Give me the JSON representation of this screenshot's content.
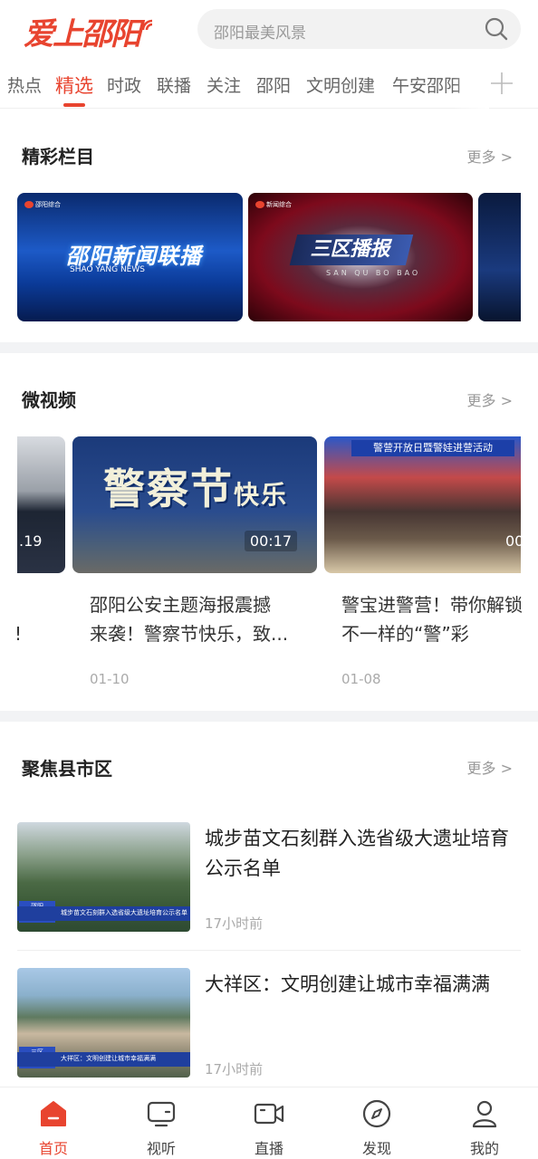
{
  "app": {
    "logo_text": "爱上邵阳",
    "search_placeholder": "邵阳最美风景"
  },
  "tabs": [
    "热点",
    "精选",
    "时政",
    "联播",
    "关注",
    "邵阳",
    "文明创建",
    "午安邵阳"
  ],
  "active_tab": "精选",
  "sections": {
    "programs": {
      "title": "精彩栏目",
      "more": "更多 >",
      "items": [
        {
          "title": "邵阳新闻联播",
          "subtitle": "SHAO YANG NEWS"
        },
        {
          "title": "三区播报",
          "subtitle": "SAN QU BO BAO"
        }
      ]
    },
    "micro_video": {
      "title": "微视频",
      "more": "更多 >",
      "partial_left_duration": ".19",
      "partial_left_text": "!",
      "items": [
        {
          "thumb_text": "警察节",
          "thumb_text_small": "快乐",
          "duration": "00:17",
          "title_line1": "邵阳公安主题海报震撼",
          "title_line2": "来袭！警察节快乐，致...",
          "date": "01-10"
        },
        {
          "thumb_banner": "警营开放日暨警娃进营活动",
          "duration": "00",
          "title_line1": "警宝进警营！带你解锁",
          "title_line2": "不一样的“警”彩",
          "date": "01-08"
        }
      ]
    },
    "county": {
      "title": "聚焦县市区",
      "more": "更多 >",
      "items": [
        {
          "title_line1": "城步苗文石刻群入选省级大遗址培育",
          "title_line2": "公示名单",
          "time": "17小时前",
          "lower_third": "城步苗文石刻群入选省级大遗址培育公示名单"
        },
        {
          "title_line1": "大祥区：文明创建让城市幸福满满",
          "title_line2": "",
          "time": "17小时前",
          "lower_third": "大祥区：文明创建让城市幸福满满"
        }
      ]
    }
  },
  "bottom_nav": [
    {
      "label": "首页",
      "icon": "home-icon",
      "active": true
    },
    {
      "label": "视听",
      "icon": "tv-icon",
      "active": false
    },
    {
      "label": "直播",
      "icon": "live-camera-icon",
      "active": false
    },
    {
      "label": "发现",
      "icon": "compass-icon",
      "active": false
    },
    {
      "label": "我的",
      "icon": "user-icon",
      "active": false
    }
  ],
  "colors": {
    "accent": "#e8442f",
    "gap": "#f2f3f5"
  }
}
